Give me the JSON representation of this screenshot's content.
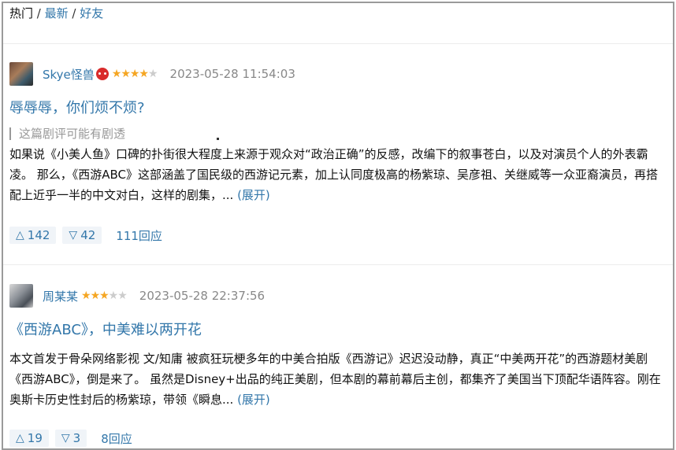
{
  "nav": {
    "hot": "热门",
    "sep1": " / ",
    "latest": "最新",
    "sep2": " / ",
    "friends": "好友"
  },
  "reviews": [
    {
      "author": "Skye怪兽",
      "badge_icon": "devil-icon",
      "stars_on": "★★★★",
      "stars_off": "★",
      "rating": 4,
      "time": "2023-05-28 11:54:03",
      "title": "辱辱辱，你们烦不烦?",
      "spoiler": "这篇剧评可能有剧透",
      "body": "如果说《小美人鱼》口碑的扑街很大程度上来源于观众对“政治正确”的反感，改编下的叙事苍白，以及对演员个人的外表霸凌。 那么，《西游ABC》这部涵盖了国民级的西游记元素，加上认同度极高的杨紫琼、吴彦祖、关继威等一众亚裔演员，再搭配上近乎一半的中文对白，这样的剧集，... ",
      "expand": "(展开)",
      "up": "142",
      "down": "42",
      "replies": "111回应"
    },
    {
      "author": "周某某",
      "stars_on": "★★★",
      "stars_off": "★★",
      "rating": 3,
      "time": "2023-05-28 22:37:56",
      "title": "《西游ABC》，中美难以两开花",
      "body": "本文首发于骨朵网络影视 文/知庸 被疯狂玩梗多年的中美合拍版《西游记》迟迟没动静，真正“中美两开花”的西游题材美剧《西游ABC》，倒是来了。 虽然是Disney+出品的纯正美剧，但本剧的幕前幕后主创，都集齐了美国当下顶配华语阵容。刚在奥斯卡历史性封后的杨紫琼，带领《瞬息... ",
      "expand": "(展开)",
      "up": "19",
      "down": "3",
      "replies": "8回应"
    }
  ],
  "colors": {
    "link": "#3377aa",
    "star": "#f5a623",
    "muted": "#888888"
  }
}
